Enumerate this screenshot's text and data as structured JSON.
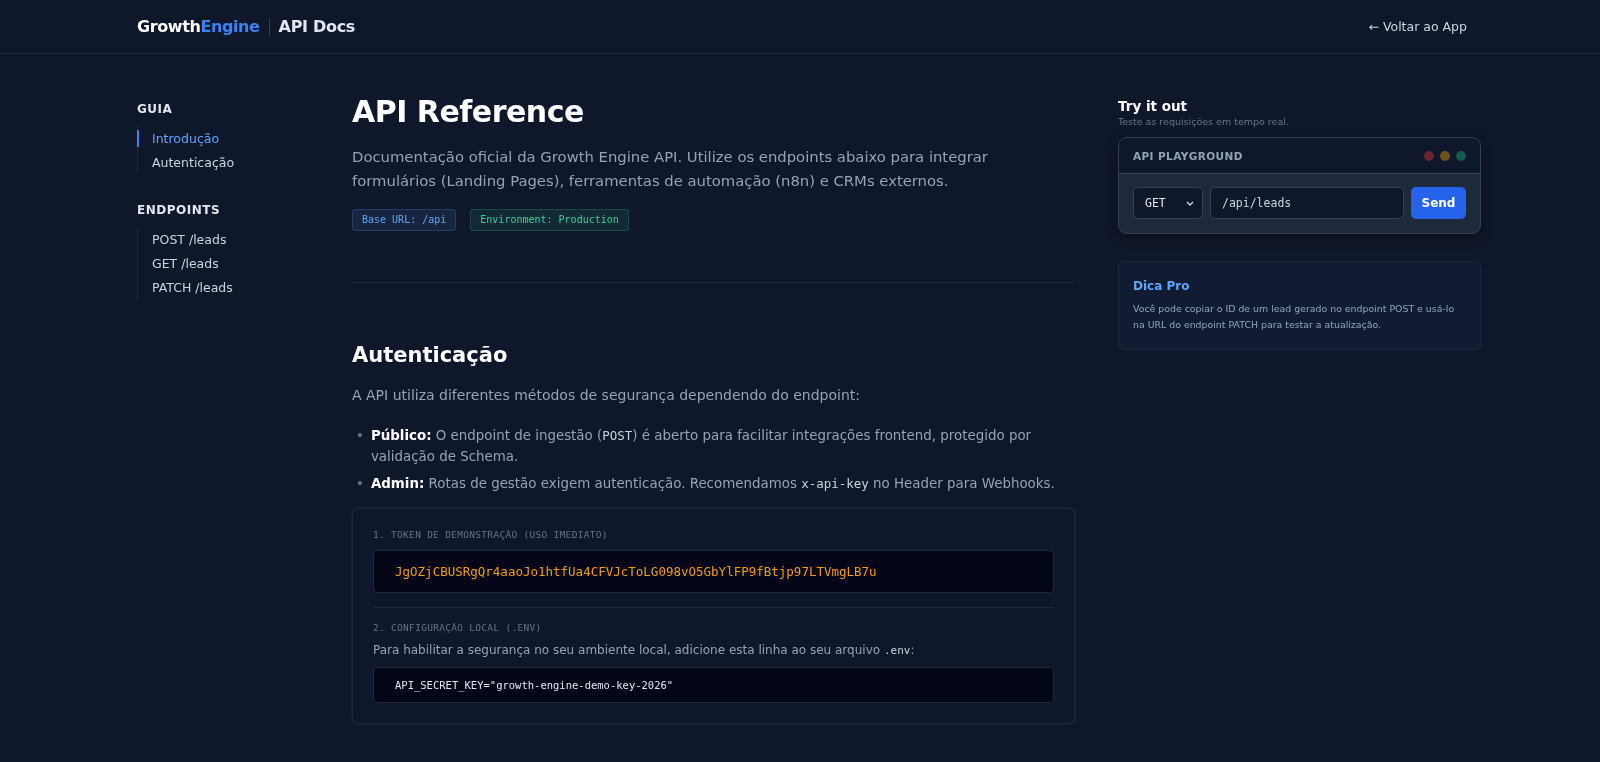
{
  "header": {
    "brand": [
      {
        "kind": "plain",
        "text": "Growth"
      },
      {
        "kind": "accent",
        "text": "Engine"
      }
    ],
    "section": "API Docs",
    "back_link": "← Voltar ao App"
  },
  "sidebar": {
    "groups": [
      {
        "title": "GUIA",
        "items": [
          {
            "label": "Introdução",
            "selected": true
          },
          {
            "label": "Autenticação",
            "selected": false
          }
        ]
      },
      {
        "title": "ENDPOINTS",
        "items": [
          {
            "label": "POST /leads",
            "selected": false
          },
          {
            "label": "GET /leads",
            "selected": false
          },
          {
            "label": "PATCH /leads",
            "selected": false
          }
        ]
      }
    ]
  },
  "intro": {
    "title": "API Reference",
    "description": "Documentação oficial da Growth Engine API. Utilize os endpoints abaixo para integrar formulários (Landing Pages), ferramentas de automação (n8n) e CRMs externos.",
    "badges": [
      {
        "text": "Base URL: /api",
        "color": "#60a5fa"
      },
      {
        "text": "Environment: Production",
        "color": "#34d399"
      }
    ]
  },
  "auth": {
    "title": "Autenticação",
    "lead": "A API utiliza diferentes métodos de segurança dependendo do endpoint:",
    "bullets": [
      {
        "marker": "•",
        "parts": [
          {
            "kind": "bold",
            "text": "Público:"
          },
          {
            "kind": "text",
            "text": " O endpoint de ingestão ("
          },
          {
            "kind": "code",
            "text": "POST"
          },
          {
            "kind": "text",
            "text": ") é aberto para facilitar integrações frontend, protegido por validação de Schema."
          }
        ]
      },
      {
        "marker": "•",
        "parts": [
          {
            "kind": "bold",
            "text": "Admin:"
          },
          {
            "kind": "text",
            "text": " Rotas de gestão exigem autenticação. Recomendamos "
          },
          {
            "kind": "code",
            "text": "x-api-key"
          },
          {
            "kind": "text",
            "text": " no Header para Webhooks."
          }
        ]
      }
    ],
    "token_label": "1. TOKEN DE DEMONSTRAÇÃO (USO IMEDIATO)",
    "token": "JgOZjCBUSRgQr4aaoJo1htfUa4CFVJcToLG098vO5GbYlFP9fBtjp97LTVmgLB7u",
    "env_label": "2. CONFIGURAÇÃO LOCAL (.ENV)",
    "env_text": [
      {
        "kind": "text",
        "text": "Para habilitar a segurança no seu ambiente local, adicione esta linha ao seu arquivo "
      },
      {
        "kind": "code",
        "text": ".env"
      },
      {
        "kind": "text",
        "text": ":"
      }
    ],
    "env_code": "API_SECRET_KEY=\"growth-engine-demo-key-2026\""
  },
  "aside": {
    "title": "Try it out",
    "subtitle": "Teste as requisições em tempo real.",
    "playground": {
      "title": "API PLAYGROUND",
      "dots": [
        {
          "color": "#6b2433"
        },
        {
          "color": "#6b5420"
        },
        {
          "color": "#145a4a"
        }
      ],
      "method": "GET",
      "url": "/api/leads",
      "send": "Send"
    },
    "tip": {
      "title": "Dica Pro",
      "text": "Você pode copiar o ID de um lead gerado no endpoint POST e usá-lo na URL do endpoint PATCH para testar a atualização."
    }
  }
}
